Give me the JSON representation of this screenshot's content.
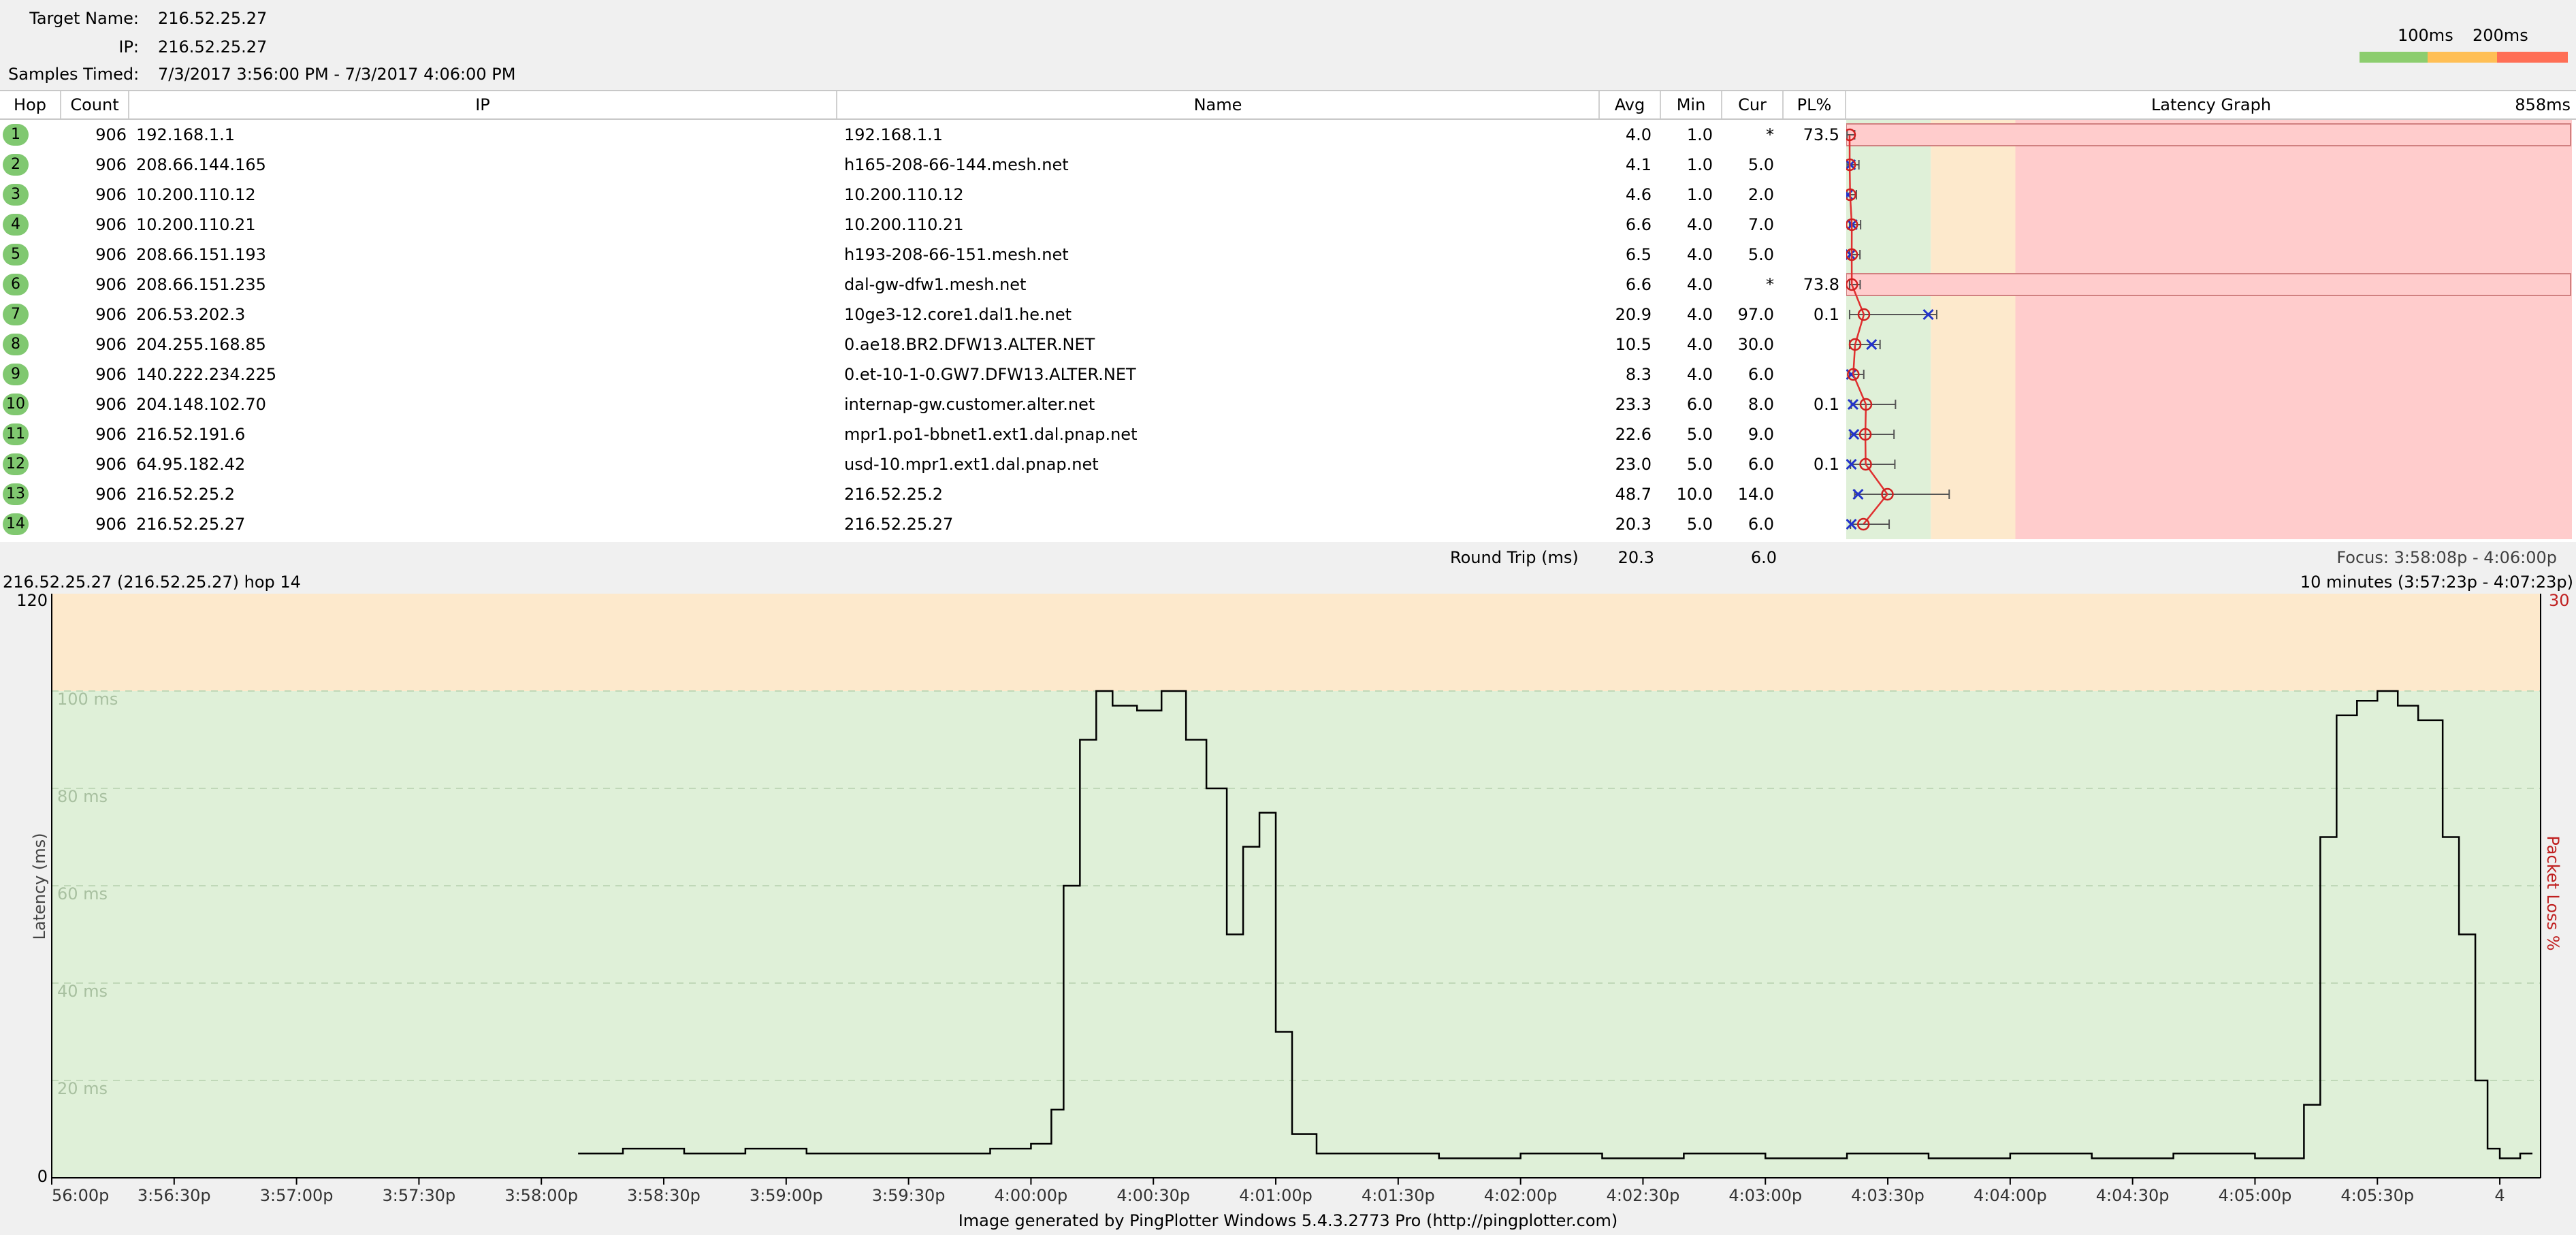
{
  "header": {
    "target_label": "Target Name:",
    "target_value": "216.52.25.27",
    "ip_label": "IP:",
    "ip_value": "216.52.25.27",
    "samples_label": "Samples Timed:",
    "samples_value": "7/3/2017 3:56:00 PM - 7/3/2017 4:06:00 PM",
    "legend_100": "100ms",
    "legend_200": "200ms",
    "legend_colors": [
      "#8ccd6e",
      "#ffbf55",
      "#ff6e55"
    ]
  },
  "table": {
    "columns": {
      "hop": "Hop",
      "count": "Count",
      "ip": "IP",
      "name": "Name",
      "avg": "Avg",
      "min": "Min",
      "cur": "Cur",
      "pl": "PL%",
      "graph": "Latency Graph",
      "graph_max": "858ms"
    },
    "rows": [
      {
        "hop": "1",
        "count": "906",
        "ip": "192.168.1.1",
        "name": "192.168.1.1",
        "avg": "4.0",
        "min": "1.0",
        "cur": "*",
        "pl": "73.5"
      },
      {
        "hop": "2",
        "count": "906",
        "ip": "208.66.144.165",
        "name": "h165-208-66-144.mesh.net",
        "avg": "4.1",
        "min": "1.0",
        "cur": "5.0",
        "pl": ""
      },
      {
        "hop": "3",
        "count": "906",
        "ip": "10.200.110.12",
        "name": "10.200.110.12",
        "avg": "4.6",
        "min": "1.0",
        "cur": "2.0",
        "pl": ""
      },
      {
        "hop": "4",
        "count": "906",
        "ip": "10.200.110.21",
        "name": "10.200.110.21",
        "avg": "6.6",
        "min": "4.0",
        "cur": "7.0",
        "pl": ""
      },
      {
        "hop": "5",
        "count": "906",
        "ip": "208.66.151.193",
        "name": "h193-208-66-151.mesh.net",
        "avg": "6.5",
        "min": "4.0",
        "cur": "5.0",
        "pl": ""
      },
      {
        "hop": "6",
        "count": "906",
        "ip": "208.66.151.235",
        "name": "dal-gw-dfw1.mesh.net",
        "avg": "6.6",
        "min": "4.0",
        "cur": "*",
        "pl": "73.8"
      },
      {
        "hop": "7",
        "count": "906",
        "ip": "206.53.202.3",
        "name": "10ge3-12.core1.dal1.he.net",
        "avg": "20.9",
        "min": "4.0",
        "cur": "97.0",
        "pl": "0.1"
      },
      {
        "hop": "8",
        "count": "906",
        "ip": "204.255.168.85",
        "name": "0.ae18.BR2.DFW13.ALTER.NET",
        "avg": "10.5",
        "min": "4.0",
        "cur": "30.0",
        "pl": ""
      },
      {
        "hop": "9",
        "count": "906",
        "ip": "140.222.234.225",
        "name": "0.et-10-1-0.GW7.DFW13.ALTER.NET",
        "avg": "8.3",
        "min": "4.0",
        "cur": "6.0",
        "pl": ""
      },
      {
        "hop": "10",
        "count": "906",
        "ip": "204.148.102.70",
        "name": "internap-gw.customer.alter.net",
        "avg": "23.3",
        "min": "6.0",
        "cur": "8.0",
        "pl": "0.1"
      },
      {
        "hop": "11",
        "count": "906",
        "ip": "216.52.191.6",
        "name": "mpr1.po1-bbnet1.ext1.dal.pnap.net",
        "avg": "22.6",
        "min": "5.0",
        "cur": "9.0",
        "pl": ""
      },
      {
        "hop": "12",
        "count": "906",
        "ip": "64.95.182.42",
        "name": "usd-10.mpr1.ext1.dal.pnap.net",
        "avg": "23.0",
        "min": "5.0",
        "cur": "6.0",
        "pl": "0.1"
      },
      {
        "hop": "13",
        "count": "906",
        "ip": "216.52.25.2",
        "name": "216.52.25.2",
        "avg": "48.7",
        "min": "10.0",
        "cur": "14.0",
        "pl": ""
      },
      {
        "hop": "14",
        "count": "906",
        "ip": "216.52.25.27",
        "name": "216.52.25.27",
        "avg": "20.3",
        "min": "5.0",
        "cur": "6.0",
        "pl": ""
      }
    ],
    "round_trip_label": "Round Trip (ms)",
    "round_trip_avg": "20.3",
    "round_trip_cur": "6.0",
    "focus": "Focus: 3:58:08p - 4:06:00p"
  },
  "detail": {
    "title": "216.52.25.27 (216.52.25.27) hop 14",
    "range": "10 minutes (3:57:23p - 4:07:23p)"
  },
  "chart_data": {
    "type": "line",
    "ylabel": "Latency (ms)",
    "y2label": "Packet Loss %",
    "y_top_label": "120",
    "y_zero_label": "0",
    "y2_top_label": "30",
    "ylim": [
      0,
      120
    ],
    "grid_labels": [
      "100 ms",
      "80 ms",
      "60 ms",
      "40 ms",
      "20 ms"
    ],
    "grid_values": [
      100,
      80,
      60,
      40,
      20
    ],
    "x_ticks": [
      "56:00p",
      "3:56:30p",
      "3:57:00p",
      "3:57:30p",
      "3:58:00p",
      "3:58:30p",
      "3:59:00p",
      "3:59:30p",
      "4:00:00p",
      "4:00:30p",
      "4:01:00p",
      "4:01:30p",
      "4:02:00p",
      "4:02:30p",
      "4:03:00p",
      "4:03:30p",
      "4:04:00p",
      "4:04:30p",
      "4:05:00p",
      "4:05:30p",
      "4"
    ],
    "x_tick_seconds": [
      0,
      30,
      60,
      90,
      120,
      150,
      180,
      210,
      240,
      270,
      300,
      330,
      360,
      390,
      420,
      450,
      480,
      510,
      540,
      570,
      600
    ],
    "xlim_seconds": [
      0,
      610
    ],
    "series": [
      {
        "x_seconds": [
          129,
          140,
          155,
          170,
          185,
          200,
          215,
          230,
          240,
          245,
          248,
          252,
          256,
          260,
          266,
          272,
          278,
          283,
          288,
          292,
          296,
          300,
          304,
          310,
          320,
          340,
          360,
          380,
          400,
          420,
          440,
          460,
          480,
          500,
          520,
          540,
          552,
          556,
          560,
          565,
          570,
          575,
          580,
          586,
          590,
          594,
          597,
          600,
          605,
          608
        ],
        "values": [
          5,
          6,
          5,
          6,
          5,
          5,
          5,
          6,
          7,
          14,
          60,
          90,
          100,
          97,
          96,
          100,
          90,
          80,
          50,
          68,
          75,
          30,
          9,
          5,
          5,
          4,
          5,
          4,
          5,
          4,
          5,
          4,
          5,
          4,
          5,
          4,
          15,
          70,
          95,
          98,
          100,
          97,
          94,
          70,
          50,
          20,
          6,
          4,
          5,
          5
        ]
      }
    ]
  }
}
